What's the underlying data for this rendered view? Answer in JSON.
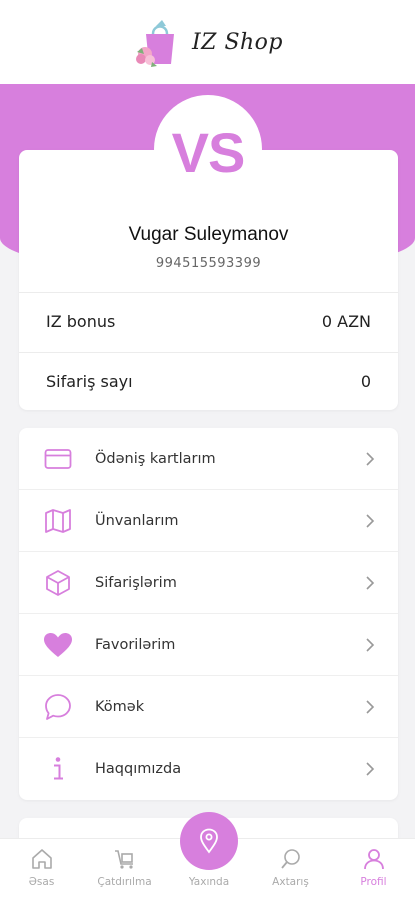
{
  "brand": {
    "name": "IZ Shop"
  },
  "profile": {
    "initials": "VS",
    "name": "Vugar Suleymanov",
    "phone": "994515593399"
  },
  "stats": [
    {
      "label": "IZ bonus",
      "value": "0 AZN"
    },
    {
      "label": "Sifariş sayı",
      "value": "0"
    }
  ],
  "menu": [
    {
      "label": "Ödəniş kartlarım",
      "icon": "credit-card-icon"
    },
    {
      "label": "Ünvanlarım",
      "icon": "map-icon"
    },
    {
      "label": "Sifarişlərim",
      "icon": "box-icon"
    },
    {
      "label": "Favorilərim",
      "icon": "heart-icon"
    },
    {
      "label": "Kömək",
      "icon": "chat-bubble-icon"
    },
    {
      "label": "Haqqımızda",
      "icon": "info-icon"
    }
  ],
  "nav": {
    "home": "Əsas",
    "delivery": "Çatdırılma",
    "nearby": "Yaxında",
    "search": "Axtarış",
    "profile": "Profil"
  },
  "colors": {
    "accent": "#d77fdd",
    "muted": "#aaaaaa",
    "background": "#f3f3f5"
  }
}
